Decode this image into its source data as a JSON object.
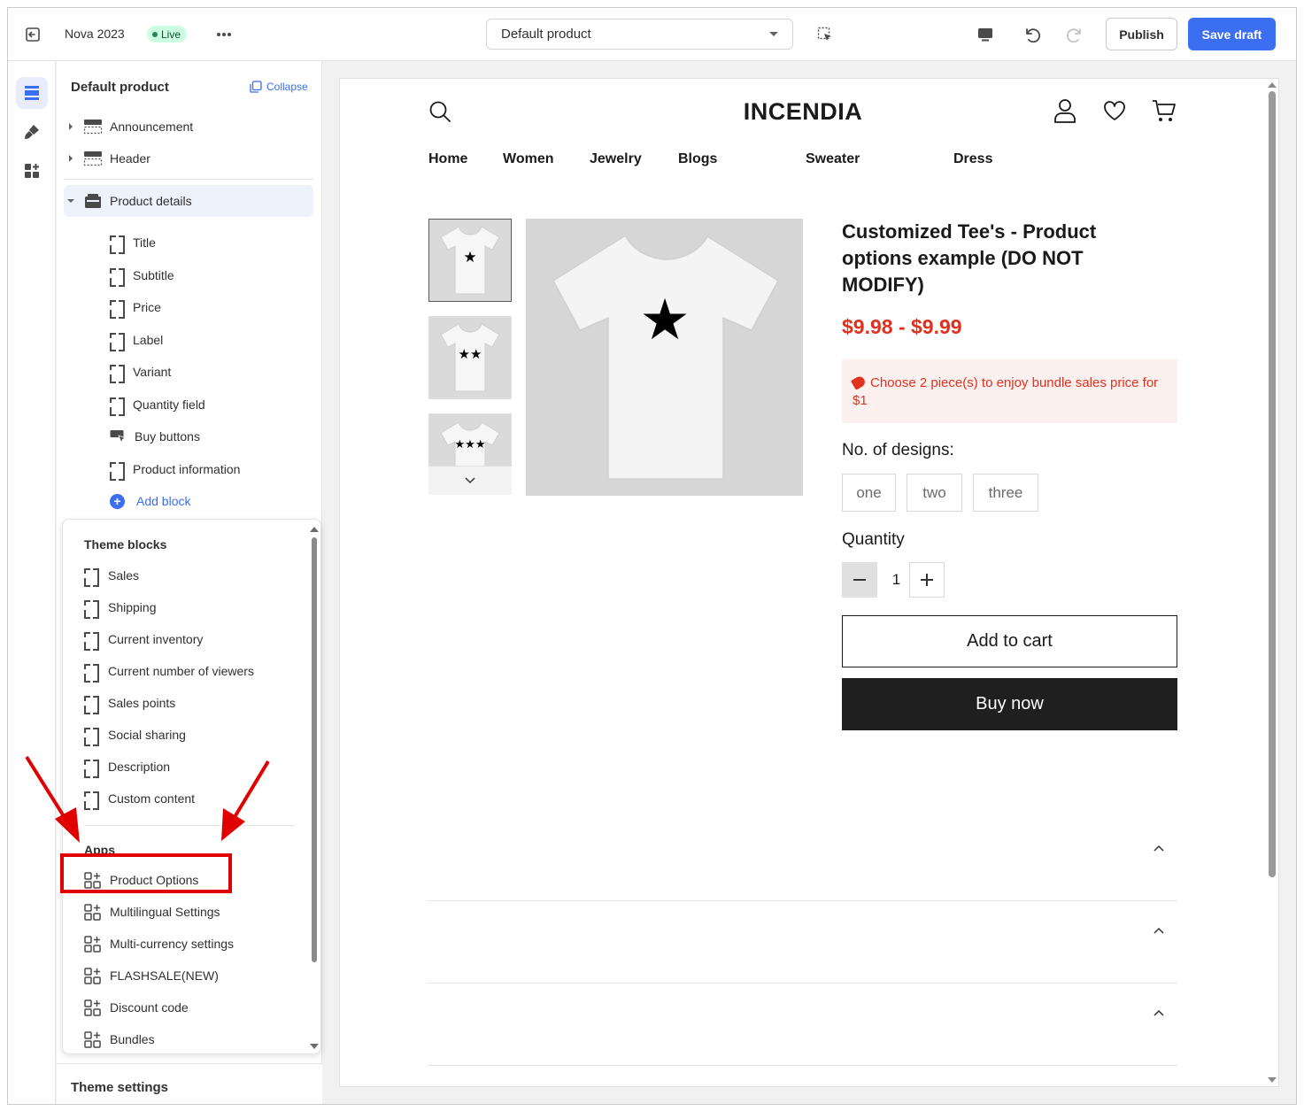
{
  "topbar": {
    "store_name": "Nova 2023",
    "live_label": "Live",
    "template_name": "Default product",
    "publish_label": "Publish",
    "save_label": "Save draft"
  },
  "sidebar": {
    "title": "Default product",
    "collapse_label": "Collapse",
    "sections": [
      {
        "label": "Announcement",
        "icon": "section-icon"
      },
      {
        "label": "Header",
        "icon": "section-icon"
      },
      {
        "label": "Product details",
        "icon": "section-icon"
      }
    ],
    "blocks": [
      "Title",
      "Subtitle",
      "Price",
      "Label",
      "Variant",
      "Quantity field",
      "Buy buttons",
      "Product information"
    ],
    "add_block_label": "Add block",
    "theme_settings_label": "Theme settings"
  },
  "popover": {
    "theme_blocks_heading": "Theme blocks",
    "theme_blocks": [
      "Sales",
      "Shipping",
      "Current inventory",
      "Current number of viewers",
      "Sales points",
      "Social sharing",
      "Description",
      "Custom content"
    ],
    "apps_heading": "Apps",
    "apps": [
      "Product Options",
      "Multilingual Settings",
      "Multi-currency settings",
      "FLASHSALE(NEW)",
      "Discount code",
      "Bundles"
    ]
  },
  "preview": {
    "brand": "INCENDIA",
    "nav": [
      "Home",
      "Women",
      "Jewelry",
      "Blogs",
      "Sweater",
      "Dress"
    ],
    "product_title": "Customized Tee's - Product options example (DO NOT MODIFY)",
    "price": "$9.98 - $9.99",
    "bundle_text": "Choose 2 piece(s) to enjoy bundle sales price for $1",
    "designs_label": "No. of designs:",
    "designs": [
      "one",
      "two",
      "three"
    ],
    "quantity_label": "Quantity",
    "quantity_value": "1",
    "add_to_cart_label": "Add to cart",
    "buy_now_label": "Buy now"
  },
  "colors": {
    "accent": "#3b6ef0",
    "price_red": "#e0311f",
    "live_green": "#29845a",
    "annotation_red": "#e00000"
  }
}
